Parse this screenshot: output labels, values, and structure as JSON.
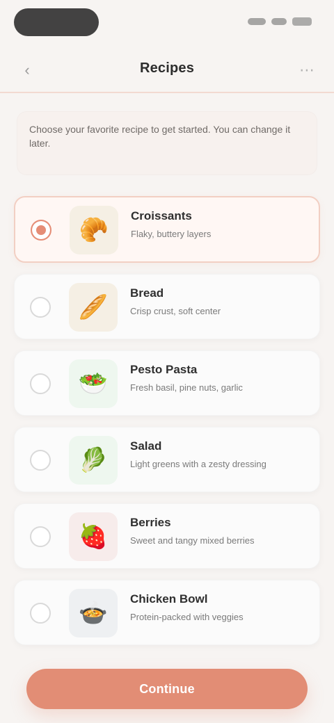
{
  "header": {
    "title": "Recipes",
    "back_glyph": "‹",
    "more_glyph": "⋯"
  },
  "intro": {
    "text": "Choose your favorite recipe to get started. You can change it later."
  },
  "items": [
    {
      "name": "Croissants",
      "desc": "Flaky, buttery layers",
      "thumb_type": "butter",
      "icon": "🥐",
      "selected": true
    },
    {
      "name": "Bread",
      "desc": "Crisp crust, soft center",
      "thumb_type": "butter",
      "icon": "🥖",
      "selected": false
    },
    {
      "name": "Pesto Pasta",
      "desc": "Fresh basil, pine nuts, garlic",
      "thumb_type": "green",
      "icon": "🥗",
      "selected": false
    },
    {
      "name": "Salad",
      "desc": "Light greens with a zesty dressing",
      "thumb_type": "green",
      "icon": "🥬",
      "selected": false
    },
    {
      "name": "Berries",
      "desc": "Sweet and tangy mixed berries",
      "thumb_type": "red",
      "icon": "🍓",
      "selected": false
    },
    {
      "name": "Chicken Bowl",
      "desc": "Protein-packed with veggies",
      "thumb_type": "gray",
      "icon": "🍲",
      "selected": false
    }
  ],
  "cta": {
    "label": "Continue"
  }
}
